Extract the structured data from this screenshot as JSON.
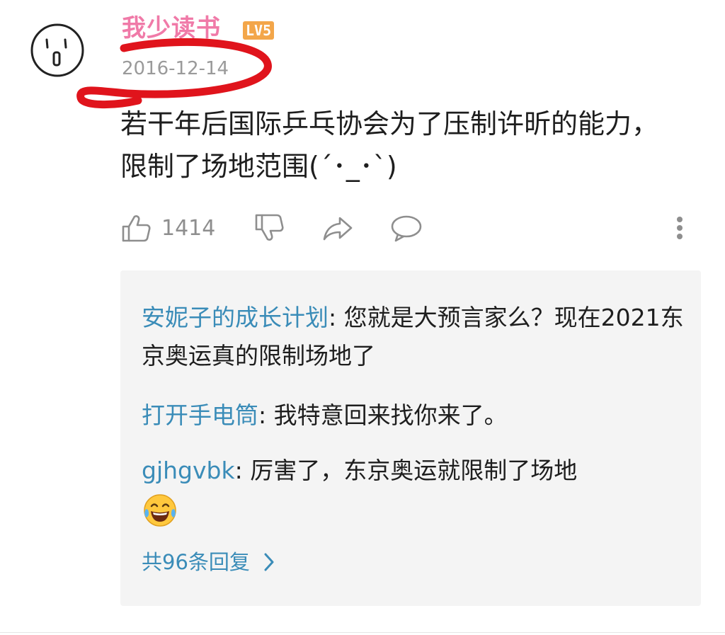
{
  "comment": {
    "username": "我少读书",
    "level": "LV5",
    "date": "2016-12-14",
    "text": "若干年后国际乒乓协会为了压制许昕的能力，限制了场地范围(´･_･`)",
    "likes": "1414",
    "icons": {
      "avatar": "hand-drawn-face-avatar",
      "like": "thumbs-up-icon",
      "dislike": "thumbs-down-icon",
      "share": "share-arrow-icon",
      "reply": "speech-bubble-icon",
      "more": "more-vertical-icon"
    },
    "annotation_color": "#e0141c"
  },
  "replies": [
    {
      "user": "安妮子的成长计划",
      "separator": ": ",
      "text": "您就是大预言家么？现在2021东京奥运真的限制场地了"
    },
    {
      "user": "打开手电筒",
      "separator": ": ",
      "text": "我特意回来找你来了。"
    },
    {
      "user": "gjhgvbk",
      "separator": ": ",
      "text": "厉害了，东京奥运就限制了场地",
      "emoji": "face-with-tears-of-joy"
    }
  ],
  "view_all": "共96条回复",
  "colors": {
    "username": "#f07aa8",
    "reply_user": "#3a8cb8",
    "badge": "#f3a64a",
    "panel": "#f4f4f4"
  }
}
